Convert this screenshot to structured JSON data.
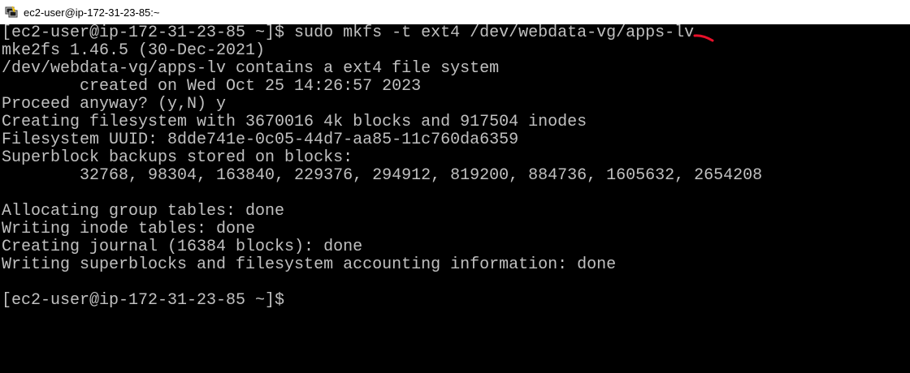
{
  "window": {
    "title": "ec2-user@ip-172-31-23-85:~",
    "icon": "putty-terminal-icon"
  },
  "terminal": {
    "lines": [
      "[ec2-user@ip-172-31-23-85 ~]$ sudo mkfs -t ext4 /dev/webdata-vg/apps-lv",
      "mke2fs 1.46.5 (30-Dec-2021)",
      "/dev/webdata-vg/apps-lv contains a ext4 file system",
      "        created on Wed Oct 25 14:26:57 2023",
      "Proceed anyway? (y,N) y",
      "Creating filesystem with 3670016 4k blocks and 917504 inodes",
      "Filesystem UUID: 8dde741e-0c05-44d7-aa85-11c760da6359",
      "Superblock backups stored on blocks:",
      "        32768, 98304, 163840, 229376, 294912, 819200, 884736, 1605632, 2654208",
      "",
      "Allocating group tables: done",
      "Writing inode tables: done",
      "Creating journal (16384 blocks): done",
      "Writing superblocks and filesystem accounting information: done",
      "",
      "[ec2-user@ip-172-31-23-85 ~]$"
    ]
  },
  "colors": {
    "background": "#000000",
    "foreground": "#c0c0c0",
    "titlebar": "#ffffff",
    "annotation": "#e8102a"
  }
}
